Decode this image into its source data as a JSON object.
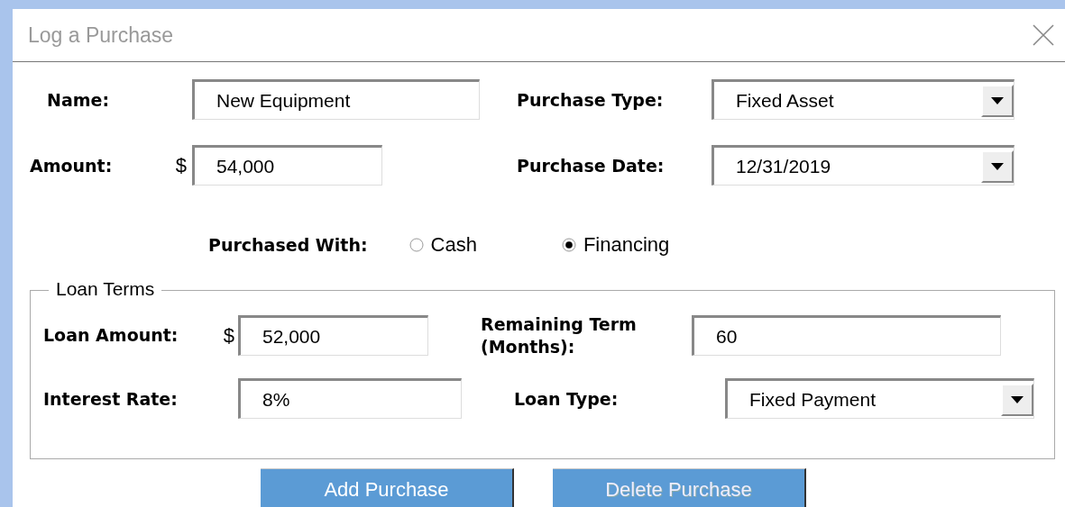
{
  "window": {
    "title": "Log a Purchase"
  },
  "fields": [
    {
      "label": "Name:",
      "kind": "text",
      "value": "New Equipment"
    },
    {
      "label": "Purchase Type:",
      "kind": "dropdown",
      "value": "Fixed Asset"
    },
    {
      "label": "Amount:",
      "kind": "text",
      "prefix": "$",
      "value": "54,000"
    },
    {
      "label": "Purchase Date:",
      "kind": "dropdown",
      "value": "12/31/2019"
    }
  ],
  "purchased_with": {
    "label": "Purchased With:",
    "options": [
      {
        "label": "Cash",
        "selected": false
      },
      {
        "label": "Financing",
        "selected": true
      }
    ]
  },
  "loan_terms": {
    "title": "Loan Terms",
    "fields": [
      {
        "label": "Loan Amount:",
        "kind": "text",
        "prefix": "$",
        "value": "52,000"
      },
      {
        "label": "Remaining Term (Months):",
        "kind": "text",
        "value": "60"
      },
      {
        "label": "Interest Rate:",
        "kind": "text",
        "value": "8%"
      },
      {
        "label": "Loan Type:",
        "kind": "dropdown",
        "value": "Fixed Payment"
      }
    ]
  },
  "buttons": [
    {
      "label": "Add Purchase",
      "disabled": false
    },
    {
      "label": "Delete Purchase",
      "disabled": true
    }
  ]
}
